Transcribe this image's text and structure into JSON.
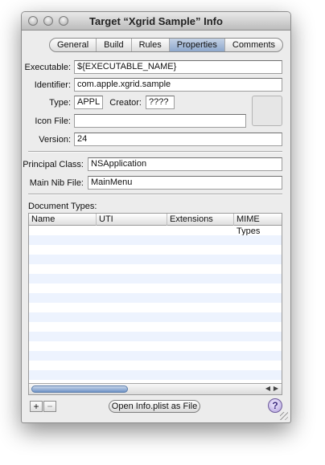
{
  "window": {
    "title": "Target “Xgrid Sample” Info"
  },
  "tabs": [
    {
      "label": "General",
      "active": false
    },
    {
      "label": "Build",
      "active": false
    },
    {
      "label": "Rules",
      "active": false
    },
    {
      "label": "Properties",
      "active": true
    },
    {
      "label": "Comments",
      "active": false
    }
  ],
  "properties": {
    "executable_label": "Executable:",
    "executable_value": "${EXECUTABLE_NAME}",
    "identifier_label": "Identifier:",
    "identifier_value": "com.apple.xgrid.sample",
    "type_label": "Type:",
    "type_value": "APPL",
    "creator_label": "Creator:",
    "creator_value": "????",
    "icon_file_label": "Icon File:",
    "icon_file_value": "",
    "version_label": "Version:",
    "version_value": "24",
    "principal_class_label": "Principal Class:",
    "principal_class_value": "NSApplication",
    "main_nib_label": "Main Nib File:",
    "main_nib_value": "MainMenu"
  },
  "document_types": {
    "label": "Document Types:",
    "columns": [
      "Name",
      "UTI",
      "Extensions",
      "MIME Types"
    ],
    "rows": []
  },
  "footer": {
    "add_label": "+",
    "remove_label": "−",
    "open_plist_label": "Open Info.plist as File",
    "help_label": "?"
  },
  "icons": [
    "close-light",
    "minimize-light",
    "zoom-light",
    "scroll-left-icon",
    "scroll-right-icon",
    "help-icon",
    "resize-grip"
  ]
}
